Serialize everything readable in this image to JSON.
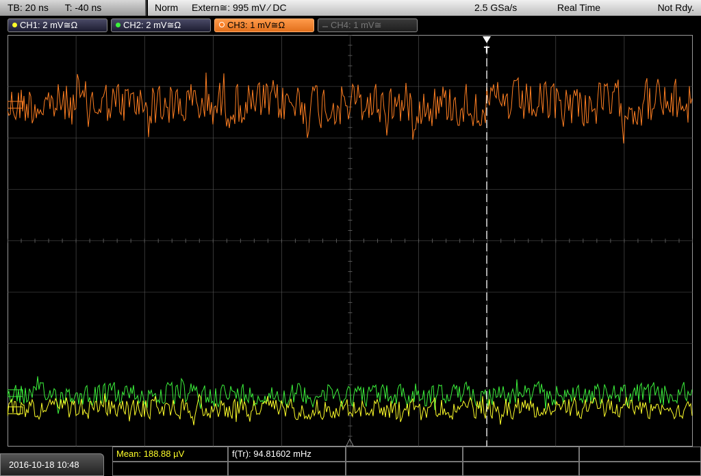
{
  "timebase": {
    "tb": "TB: 20 ns",
    "t": "T: -40 ns"
  },
  "status": {
    "mode": "Norm",
    "trigger": "Extern≅: 995 mV ⁄ DC",
    "sample_rate": "2.5 GSa/s",
    "acq": "Real Time",
    "ready": "Not Rdy."
  },
  "channels": [
    {
      "label": "CH1: 2 mV≅Ω",
      "color": "#ffff2a",
      "state": "on"
    },
    {
      "label": "CH2: 2 mV≅Ω",
      "color": "#3cf23c",
      "state": "on"
    },
    {
      "label": "CH3: 1 mV≅Ω",
      "color": "#ff7f22",
      "state": "active"
    },
    {
      "label": "CH4: 1 mV≅",
      "color": "#777777",
      "state": "off"
    }
  ],
  "trigger_marker": "T",
  "measurements": {
    "mean": "Mean: 188.88 µV",
    "freq": "f(Tr): 94.81602 mHz"
  },
  "datetime": "2016-10-18 10:48",
  "colors": {
    "ch1": "#ffff2a",
    "ch2": "#3cf23c",
    "ch3": "#ff7f22",
    "grid": "#5a5a5a"
  }
}
